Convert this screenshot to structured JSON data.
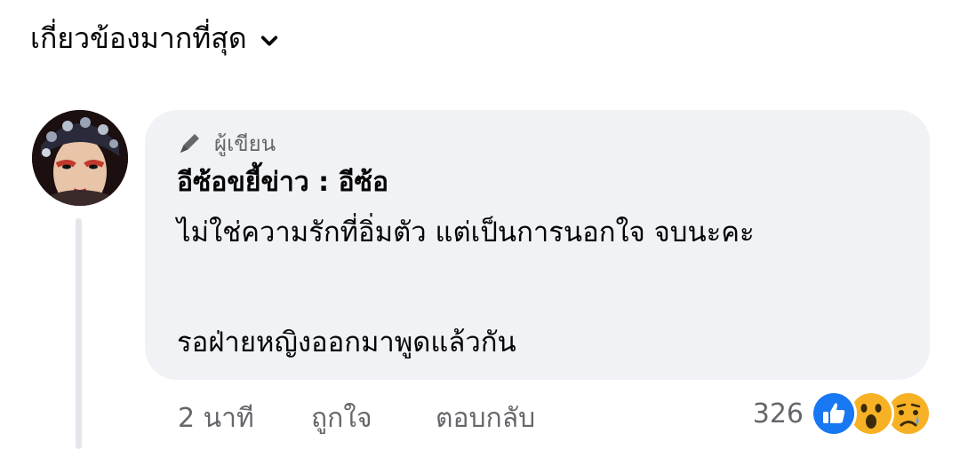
{
  "sort": {
    "label": "เกี่ยวข้องมากที่สุด"
  },
  "comment": {
    "badge": "ผู้เขียน",
    "author": "อีซ้อขยี้ข่าว : อีซ้อ",
    "lines": [
      "ไม่ใช่ความรักที่อิ่มตัว แต่เป็นการนอกใจ จบนะคะ",
      "รอฝ่ายหญิงออกมาพูดแล้วกัน"
    ],
    "time": "2 นาที",
    "like_label": "ถูกใจ",
    "reply_label": "ตอบกลับ",
    "reaction_count": "326",
    "reactions": [
      "like-icon",
      "wow-icon",
      "sad-icon"
    ]
  },
  "colors": {
    "bubble": "#f0f2f5",
    "meta_text": "#65676b",
    "like_blue": "#1877f2",
    "emoji_yellow": "#f7b125"
  }
}
